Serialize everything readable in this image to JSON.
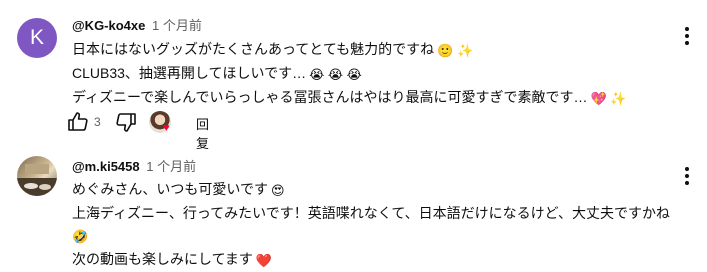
{
  "comments": [
    {
      "avatar_letter": "K",
      "author": "@KG-ko4xe",
      "timestamp": "1 个月前",
      "lines": [
        {
          "text": "日本にはないグッズがたくさんあってとても魅力的ですね",
          "emoji": "🙂 ✨"
        },
        {
          "text": "CLUB33、抽選再開してほしいです…",
          "emoji": "😭 😭 😭"
        },
        {
          "text": "ディズニーで楽しんでいらっしゃる冨張さんはやはり最高に可愛すぎで素敵です…",
          "emoji": "💖 ✨"
        }
      ],
      "likes": "3",
      "reply_label": "回复",
      "creator_heart": "♥"
    },
    {
      "author": "@m.ki5458",
      "timestamp": "1 个月前",
      "lines": [
        {
          "text": "めぐみさん、いつも可愛いです",
          "emoji": "😍"
        },
        {
          "text": "上海ディズニー、行ってみたいです！英語喋れなくて、日本語だけになるけど、大丈夫ですかね",
          "emoji": ""
        },
        {
          "text": "",
          "emoji": "🤣"
        },
        {
          "text": "次の動画も楽しみにしてます",
          "emoji": "❤️"
        }
      ]
    }
  ],
  "colors": {
    "avatar_k": "#7e57c2",
    "text": "#0f0f0f",
    "secondary": "#606060",
    "heart": "#ff0033"
  }
}
